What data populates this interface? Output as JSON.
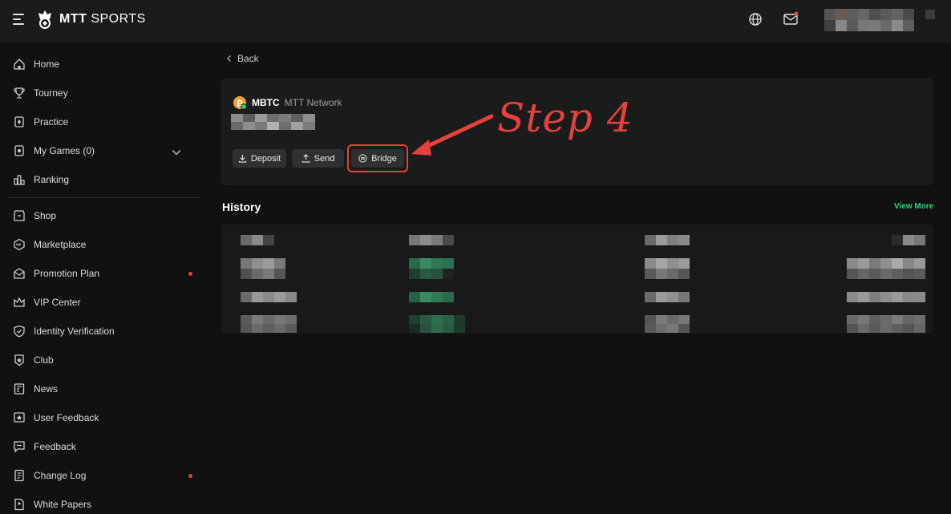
{
  "brand": {
    "name_bold": "MTT",
    "name_thin": "SPORTS"
  },
  "sidebar": {
    "items": [
      {
        "label": "Home",
        "icon": "home-icon"
      },
      {
        "label": "Tourney",
        "icon": "trophy-icon"
      },
      {
        "label": "Practice",
        "icon": "cards-icon"
      },
      {
        "label": "My Games (0)",
        "icon": "games-icon",
        "expandable": true
      },
      {
        "label": "Ranking",
        "icon": "ranking-icon"
      },
      {
        "label": "Shop",
        "icon": "shop-icon"
      },
      {
        "label": "Marketplace",
        "icon": "nft-icon"
      },
      {
        "label": "Promotion Plan",
        "icon": "promotion-icon",
        "dot": true
      },
      {
        "label": "VIP Center",
        "icon": "crown-icon"
      },
      {
        "label": "Identity Verification",
        "icon": "shield-icon"
      },
      {
        "label": "Club",
        "icon": "club-icon"
      },
      {
        "label": "News",
        "icon": "news-icon"
      },
      {
        "label": "User Feedback",
        "icon": "star-icon"
      },
      {
        "label": "Feedback",
        "icon": "feedback-icon"
      },
      {
        "label": "Change Log",
        "icon": "changelog-icon",
        "dot": true
      },
      {
        "label": "White Papers",
        "icon": "paper-icon"
      }
    ]
  },
  "main": {
    "back_label": "Back",
    "asset": {
      "symbol": "MBTC",
      "network": "MTT Network"
    },
    "actions": {
      "deposit": "Deposit",
      "send": "Send",
      "bridge": "Bridge"
    },
    "annotation": "Step 4",
    "history": {
      "title": "History",
      "view_more": "View More"
    }
  },
  "colors": {
    "accent_green": "#2ed17a",
    "annotation_red": "#e8403a",
    "notification_dot": "#e0463d"
  }
}
